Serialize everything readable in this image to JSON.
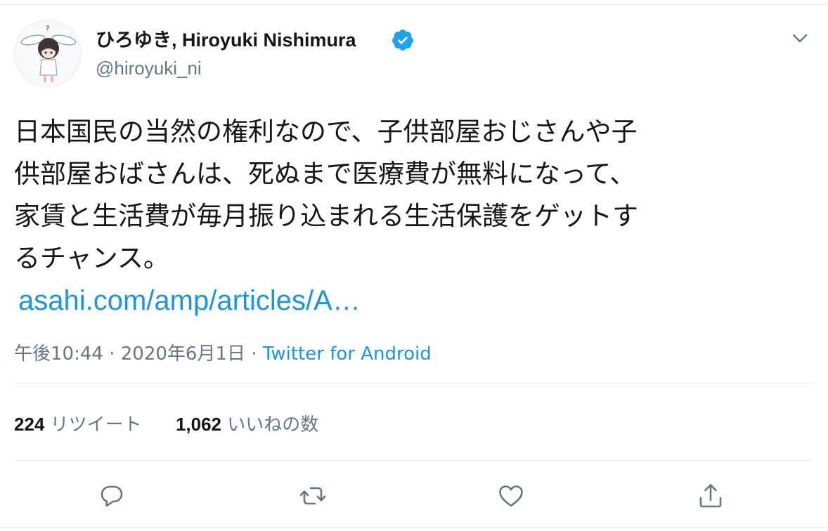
{
  "author": {
    "name": "ひろゆき, Hiroyuki Nishimura",
    "handle": "@hiroyuki_ni",
    "verified": true
  },
  "tweet": {
    "lines": [
      "日本国民の当然の権利なので、子供部屋おじさんや子",
      "供部屋おばさんは、死ぬまで医療費が無料になって、",
      "家賃と生活費が毎月振り込まれる生活保護をゲットす",
      "るチャンス。"
    ],
    "link": "asahi.com/amp/articles/A…"
  },
  "meta": {
    "time": "午後10:44",
    "separator": "·",
    "date": "2020年6月1日",
    "source": "Twitter for Android"
  },
  "stats": {
    "retweets": "224",
    "retweets_label": "リツイート",
    "likes": "1,062",
    "likes_label": "いいねの数"
  },
  "icons": {
    "caret": "chevron-down-icon",
    "verified": "verified-badge-icon",
    "reply": "reply-icon",
    "retweet": "retweet-icon",
    "like": "heart-icon",
    "share": "share-icon"
  },
  "colors": {
    "text": "#14171a",
    "secondary": "#657786",
    "link": "#1b95e0",
    "verified": "#1da1f2",
    "border": "#e6ecf0"
  }
}
